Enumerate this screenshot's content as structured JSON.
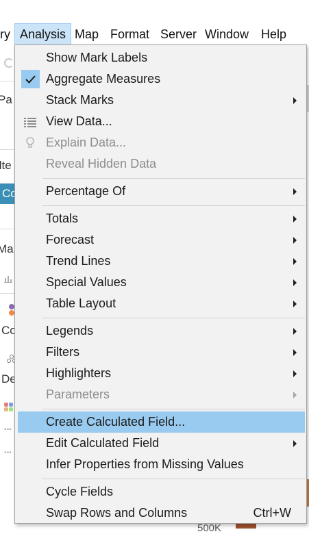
{
  "menubar": {
    "items": [
      {
        "label": "ry"
      },
      {
        "label": "Analysis"
      },
      {
        "label": "Map"
      },
      {
        "label": "Format"
      },
      {
        "label": "Server"
      },
      {
        "label": "Window"
      },
      {
        "label": "Help"
      }
    ]
  },
  "background": {
    "fragments": [
      "Pa",
      "ilte",
      "Co",
      "Ma",
      "Co",
      "De"
    ],
    "bottom_fragment": "500K"
  },
  "menu": {
    "items": [
      {
        "label": "Show Mark Labels"
      },
      {
        "label": "Aggregate Measures",
        "checked": true
      },
      {
        "label": "Stack Marks",
        "submenu": true
      },
      {
        "label": "View Data...",
        "icon": "view-data-icon"
      },
      {
        "label": "Explain Data...",
        "icon": "lightbulb-icon",
        "disabled": true
      },
      {
        "label": "Reveal Hidden Data",
        "disabled": true
      },
      {
        "label": "Percentage Of",
        "submenu": true
      },
      {
        "label": "Totals",
        "submenu": true
      },
      {
        "label": "Forecast",
        "submenu": true
      },
      {
        "label": "Trend Lines",
        "submenu": true
      },
      {
        "label": "Special Values",
        "submenu": true
      },
      {
        "label": "Table Layout",
        "submenu": true
      },
      {
        "label": "Legends",
        "submenu": true
      },
      {
        "label": "Filters",
        "submenu": true
      },
      {
        "label": "Highlighters",
        "submenu": true
      },
      {
        "label": "Parameters",
        "submenu": true,
        "disabled": true
      },
      {
        "label": "Create Calculated Field...",
        "highlighted": true
      },
      {
        "label": "Edit Calculated Field",
        "submenu": true
      },
      {
        "label": "Infer Properties from Missing Values"
      },
      {
        "label": "Cycle Fields"
      },
      {
        "label": "Swap Rows and Columns",
        "shortcut": "Ctrl+W"
      }
    ]
  },
  "colors": {
    "highlight": "#99cbf0",
    "menu_bg": "#f2f2f2",
    "active_menu_bg": "#cce4f7",
    "pill": "#3b8eb5"
  }
}
